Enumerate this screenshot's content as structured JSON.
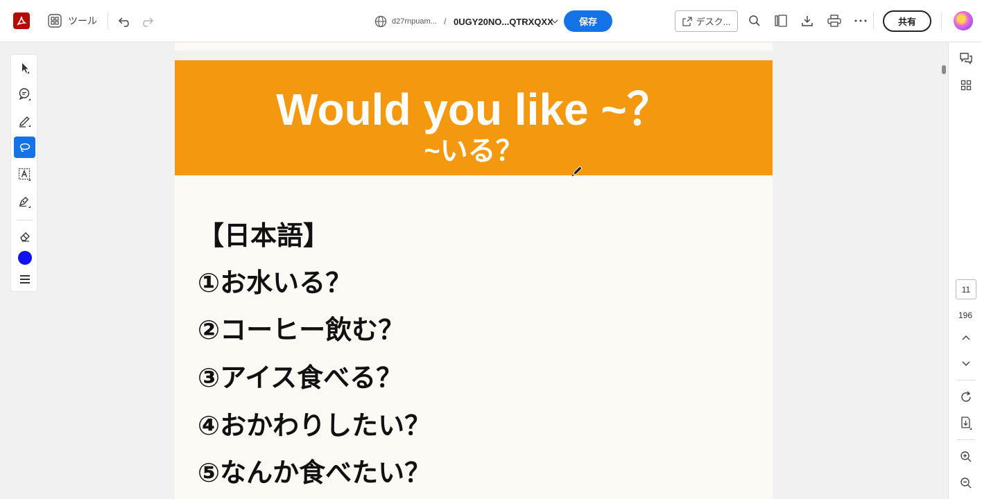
{
  "toolbar": {
    "tools_label": "ツール",
    "domain": "d27rnpuam...",
    "separator": "/",
    "filename": "0UGY20NO...QTRXQXX",
    "save_label": "保存",
    "desktop_label": "デスク...",
    "share_label": "共有"
  },
  "left_tools": [
    {
      "icon": "select-arrow-icon"
    },
    {
      "icon": "comment-icon"
    },
    {
      "icon": "highlight-pen-icon"
    },
    {
      "icon": "lasso-draw-icon",
      "active": true
    },
    {
      "icon": "text-box-icon"
    },
    {
      "icon": "signature-pen-icon"
    },
    {
      "icon": "eraser-icon"
    },
    {
      "icon": "color-picker",
      "color": "#1212f0"
    },
    {
      "icon": "stroke-width-icon"
    }
  ],
  "document": {
    "banner_title": "Would you like ~？",
    "banner_subtitle": "~いる？",
    "banner_color": "#f4990f",
    "lines": [
      "【日本語】",
      "①お水いる？",
      "②コーヒー飲む？",
      "③アイス食べる？",
      "④おかわりしたい？",
      "⑤なんか食べたい？"
    ]
  },
  "right_rail": {
    "current_page": "11",
    "total_pages": "196"
  },
  "colors": {
    "accent": "#1473e6",
    "acrobat_red": "#b30b00"
  }
}
